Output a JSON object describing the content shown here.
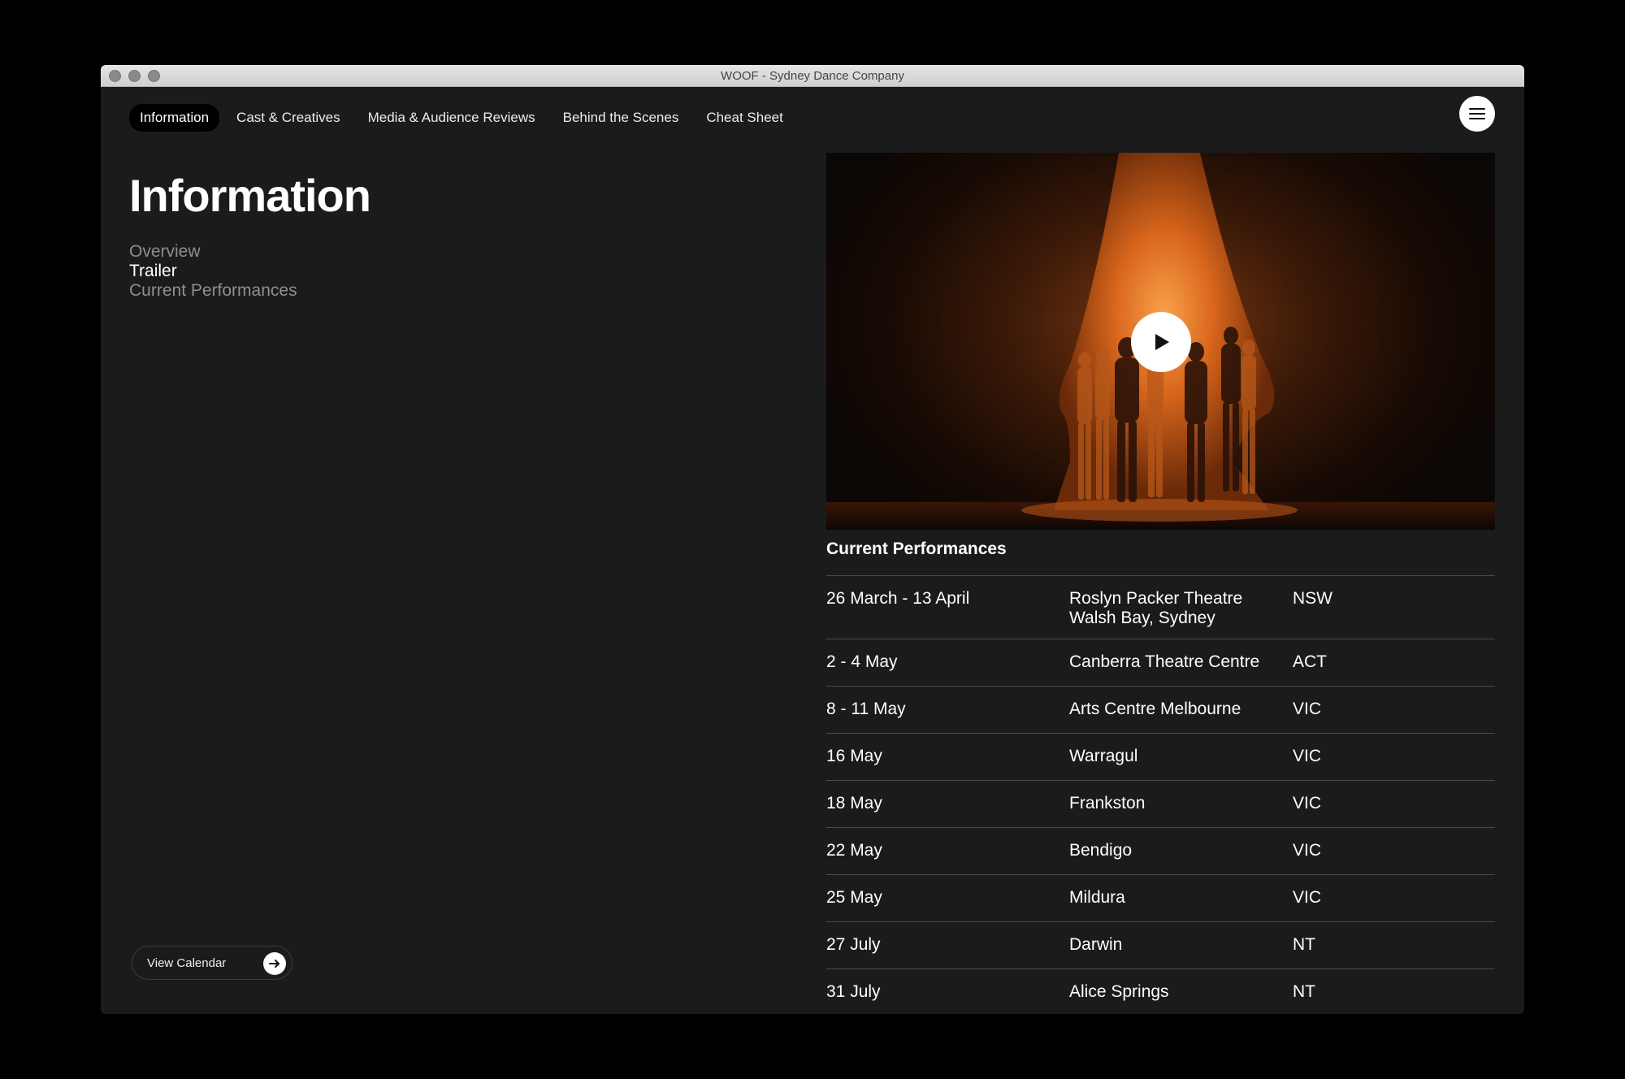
{
  "window": {
    "title": "WOOF - Sydney Dance Company"
  },
  "nav": {
    "items": [
      {
        "label": "Information",
        "active": true
      },
      {
        "label": "Cast & Creatives",
        "active": false
      },
      {
        "label": "Media & Audience Reviews",
        "active": false
      },
      {
        "label": "Behind the Scenes",
        "active": false
      },
      {
        "label": "Cheat Sheet",
        "active": false
      }
    ],
    "menu_icon": "hamburger-icon"
  },
  "page": {
    "title": "Information",
    "sections": [
      {
        "label": "Overview",
        "current": false
      },
      {
        "label": "Trailer",
        "current": true
      },
      {
        "label": "Current Performances",
        "current": false
      }
    ]
  },
  "calendar_button": {
    "label": "View Calendar",
    "icon": "arrow-right-icon"
  },
  "video": {
    "play_icon": "play-icon"
  },
  "performances": {
    "heading": "Current Performances",
    "rows": [
      {
        "dates": "26 March - 13 April",
        "venue": "Roslyn Packer Theatre\nWalsh Bay, Sydney",
        "venue_line1": "Roslyn Packer Theatre",
        "venue_line2": "Walsh Bay, Sydney",
        "state": "NSW"
      },
      {
        "dates": "2 - 4 May",
        "venue_line1": "Canberra Theatre Centre",
        "state": "ACT"
      },
      {
        "dates": "8 - 11 May",
        "venue_line1": "Arts Centre Melbourne",
        "state": "VIC"
      },
      {
        "dates": "16 May",
        "venue_line1": "Warragul",
        "state": "VIC"
      },
      {
        "dates": "18 May",
        "venue_line1": "Frankston",
        "state": "VIC"
      },
      {
        "dates": "22 May",
        "venue_line1": "Bendigo",
        "state": "VIC"
      },
      {
        "dates": "25 May",
        "venue_line1": "Mildura",
        "state": "VIC"
      },
      {
        "dates": "27 July",
        "venue_line1": "Darwin",
        "state": "NT"
      },
      {
        "dates": "31 July",
        "venue_line1": "Alice Springs",
        "state": "NT"
      }
    ]
  },
  "colors": {
    "page_background": "#1b1b1b",
    "outer_background": "#000000",
    "text": "#ffffff",
    "muted_text": "#8f8f8f",
    "active_pill": "#000000",
    "video_accent": "#e0782a"
  }
}
